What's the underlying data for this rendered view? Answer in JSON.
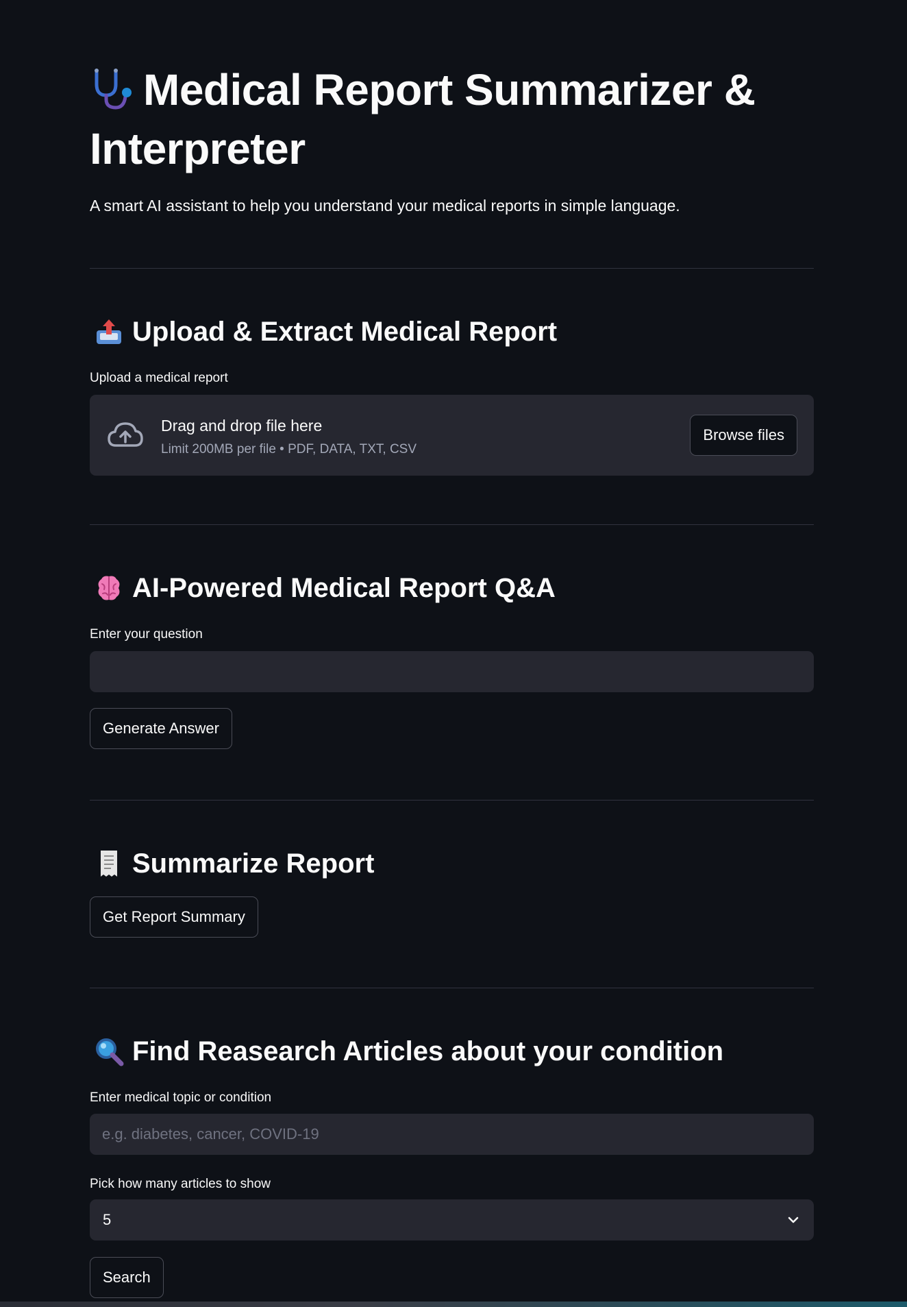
{
  "header": {
    "emoji": "stethoscope-icon",
    "title": "Medical Report Summarizer & Interpreter",
    "subtitle": "A smart AI assistant to help you understand your medical reports in simple language."
  },
  "upload_section": {
    "icon": "outbox-tray-icon",
    "heading": "Upload & Extract Medical Report",
    "label": "Upload a medical report",
    "dropzone_title": "Drag and drop file here",
    "dropzone_limit": "Limit 200MB per file • PDF, DATA, TXT, CSV",
    "browse_label": "Browse files"
  },
  "qa_section": {
    "icon": "brain-icon",
    "heading": "AI-Powered Medical Report Q&A",
    "label": "Enter your question",
    "question_value": "",
    "question_placeholder": "",
    "button_label": "Generate Answer"
  },
  "summary_section": {
    "icon": "receipt-icon",
    "heading": "Summarize Report",
    "button_label": "Get Report Summary"
  },
  "research_section": {
    "icon": "magnifying-glass-icon",
    "heading": "Find Reasearch Articles about your condition",
    "topic_label": "Enter medical topic or condition",
    "topic_value": "",
    "topic_placeholder": "e.g. diabetes, cancer, COVID-19",
    "count_label": "Pick how many articles to show",
    "count_value": "5",
    "search_label": "Search"
  },
  "colors": {
    "background": "#0e1117",
    "surface": "#262730",
    "text": "#fafafa",
    "muted_text": "#a3a8b8",
    "divider": "#31333f"
  }
}
